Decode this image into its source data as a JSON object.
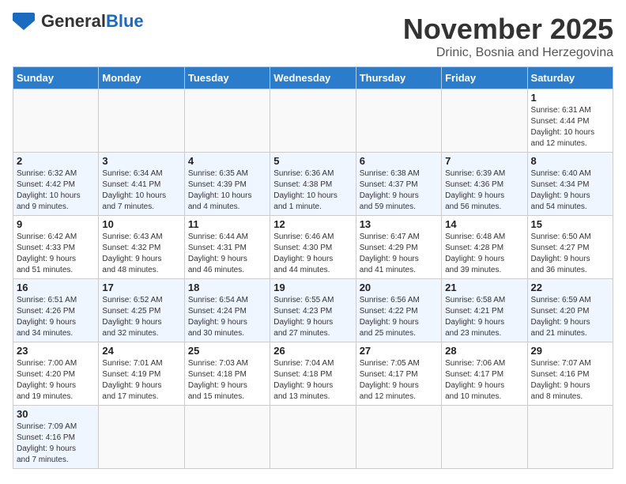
{
  "header": {
    "logo_line1": "General",
    "logo_line2": "Blue",
    "title": "November 2025",
    "subtitle": "Drinic, Bosnia and Herzegovina"
  },
  "weekdays": [
    "Sunday",
    "Monday",
    "Tuesday",
    "Wednesday",
    "Thursday",
    "Friday",
    "Saturday"
  ],
  "weeks": [
    [
      {
        "day": "",
        "info": ""
      },
      {
        "day": "",
        "info": ""
      },
      {
        "day": "",
        "info": ""
      },
      {
        "day": "",
        "info": ""
      },
      {
        "day": "",
        "info": ""
      },
      {
        "day": "",
        "info": ""
      },
      {
        "day": "1",
        "info": "Sunrise: 6:31 AM\nSunset: 4:44 PM\nDaylight: 10 hours\nand 12 minutes."
      }
    ],
    [
      {
        "day": "2",
        "info": "Sunrise: 6:32 AM\nSunset: 4:42 PM\nDaylight: 10 hours\nand 9 minutes."
      },
      {
        "day": "3",
        "info": "Sunrise: 6:34 AM\nSunset: 4:41 PM\nDaylight: 10 hours\nand 7 minutes."
      },
      {
        "day": "4",
        "info": "Sunrise: 6:35 AM\nSunset: 4:39 PM\nDaylight: 10 hours\nand 4 minutes."
      },
      {
        "day": "5",
        "info": "Sunrise: 6:36 AM\nSunset: 4:38 PM\nDaylight: 10 hours\nand 1 minute."
      },
      {
        "day": "6",
        "info": "Sunrise: 6:38 AM\nSunset: 4:37 PM\nDaylight: 9 hours\nand 59 minutes."
      },
      {
        "day": "7",
        "info": "Sunrise: 6:39 AM\nSunset: 4:36 PM\nDaylight: 9 hours\nand 56 minutes."
      },
      {
        "day": "8",
        "info": "Sunrise: 6:40 AM\nSunset: 4:34 PM\nDaylight: 9 hours\nand 54 minutes."
      }
    ],
    [
      {
        "day": "9",
        "info": "Sunrise: 6:42 AM\nSunset: 4:33 PM\nDaylight: 9 hours\nand 51 minutes."
      },
      {
        "day": "10",
        "info": "Sunrise: 6:43 AM\nSunset: 4:32 PM\nDaylight: 9 hours\nand 48 minutes."
      },
      {
        "day": "11",
        "info": "Sunrise: 6:44 AM\nSunset: 4:31 PM\nDaylight: 9 hours\nand 46 minutes."
      },
      {
        "day": "12",
        "info": "Sunrise: 6:46 AM\nSunset: 4:30 PM\nDaylight: 9 hours\nand 44 minutes."
      },
      {
        "day": "13",
        "info": "Sunrise: 6:47 AM\nSunset: 4:29 PM\nDaylight: 9 hours\nand 41 minutes."
      },
      {
        "day": "14",
        "info": "Sunrise: 6:48 AM\nSunset: 4:28 PM\nDaylight: 9 hours\nand 39 minutes."
      },
      {
        "day": "15",
        "info": "Sunrise: 6:50 AM\nSunset: 4:27 PM\nDaylight: 9 hours\nand 36 minutes."
      }
    ],
    [
      {
        "day": "16",
        "info": "Sunrise: 6:51 AM\nSunset: 4:26 PM\nDaylight: 9 hours\nand 34 minutes."
      },
      {
        "day": "17",
        "info": "Sunrise: 6:52 AM\nSunset: 4:25 PM\nDaylight: 9 hours\nand 32 minutes."
      },
      {
        "day": "18",
        "info": "Sunrise: 6:54 AM\nSunset: 4:24 PM\nDaylight: 9 hours\nand 30 minutes."
      },
      {
        "day": "19",
        "info": "Sunrise: 6:55 AM\nSunset: 4:23 PM\nDaylight: 9 hours\nand 27 minutes."
      },
      {
        "day": "20",
        "info": "Sunrise: 6:56 AM\nSunset: 4:22 PM\nDaylight: 9 hours\nand 25 minutes."
      },
      {
        "day": "21",
        "info": "Sunrise: 6:58 AM\nSunset: 4:21 PM\nDaylight: 9 hours\nand 23 minutes."
      },
      {
        "day": "22",
        "info": "Sunrise: 6:59 AM\nSunset: 4:20 PM\nDaylight: 9 hours\nand 21 minutes."
      }
    ],
    [
      {
        "day": "23",
        "info": "Sunrise: 7:00 AM\nSunset: 4:20 PM\nDaylight: 9 hours\nand 19 minutes."
      },
      {
        "day": "24",
        "info": "Sunrise: 7:01 AM\nSunset: 4:19 PM\nDaylight: 9 hours\nand 17 minutes."
      },
      {
        "day": "25",
        "info": "Sunrise: 7:03 AM\nSunset: 4:18 PM\nDaylight: 9 hours\nand 15 minutes."
      },
      {
        "day": "26",
        "info": "Sunrise: 7:04 AM\nSunset: 4:18 PM\nDaylight: 9 hours\nand 13 minutes."
      },
      {
        "day": "27",
        "info": "Sunrise: 7:05 AM\nSunset: 4:17 PM\nDaylight: 9 hours\nand 12 minutes."
      },
      {
        "day": "28",
        "info": "Sunrise: 7:06 AM\nSunset: 4:17 PM\nDaylight: 9 hours\nand 10 minutes."
      },
      {
        "day": "29",
        "info": "Sunrise: 7:07 AM\nSunset: 4:16 PM\nDaylight: 9 hours\nand 8 minutes."
      }
    ],
    [
      {
        "day": "30",
        "info": "Sunrise: 7:09 AM\nSunset: 4:16 PM\nDaylight: 9 hours\nand 7 minutes."
      },
      {
        "day": "",
        "info": ""
      },
      {
        "day": "",
        "info": ""
      },
      {
        "day": "",
        "info": ""
      },
      {
        "day": "",
        "info": ""
      },
      {
        "day": "",
        "info": ""
      },
      {
        "day": "",
        "info": ""
      }
    ]
  ]
}
